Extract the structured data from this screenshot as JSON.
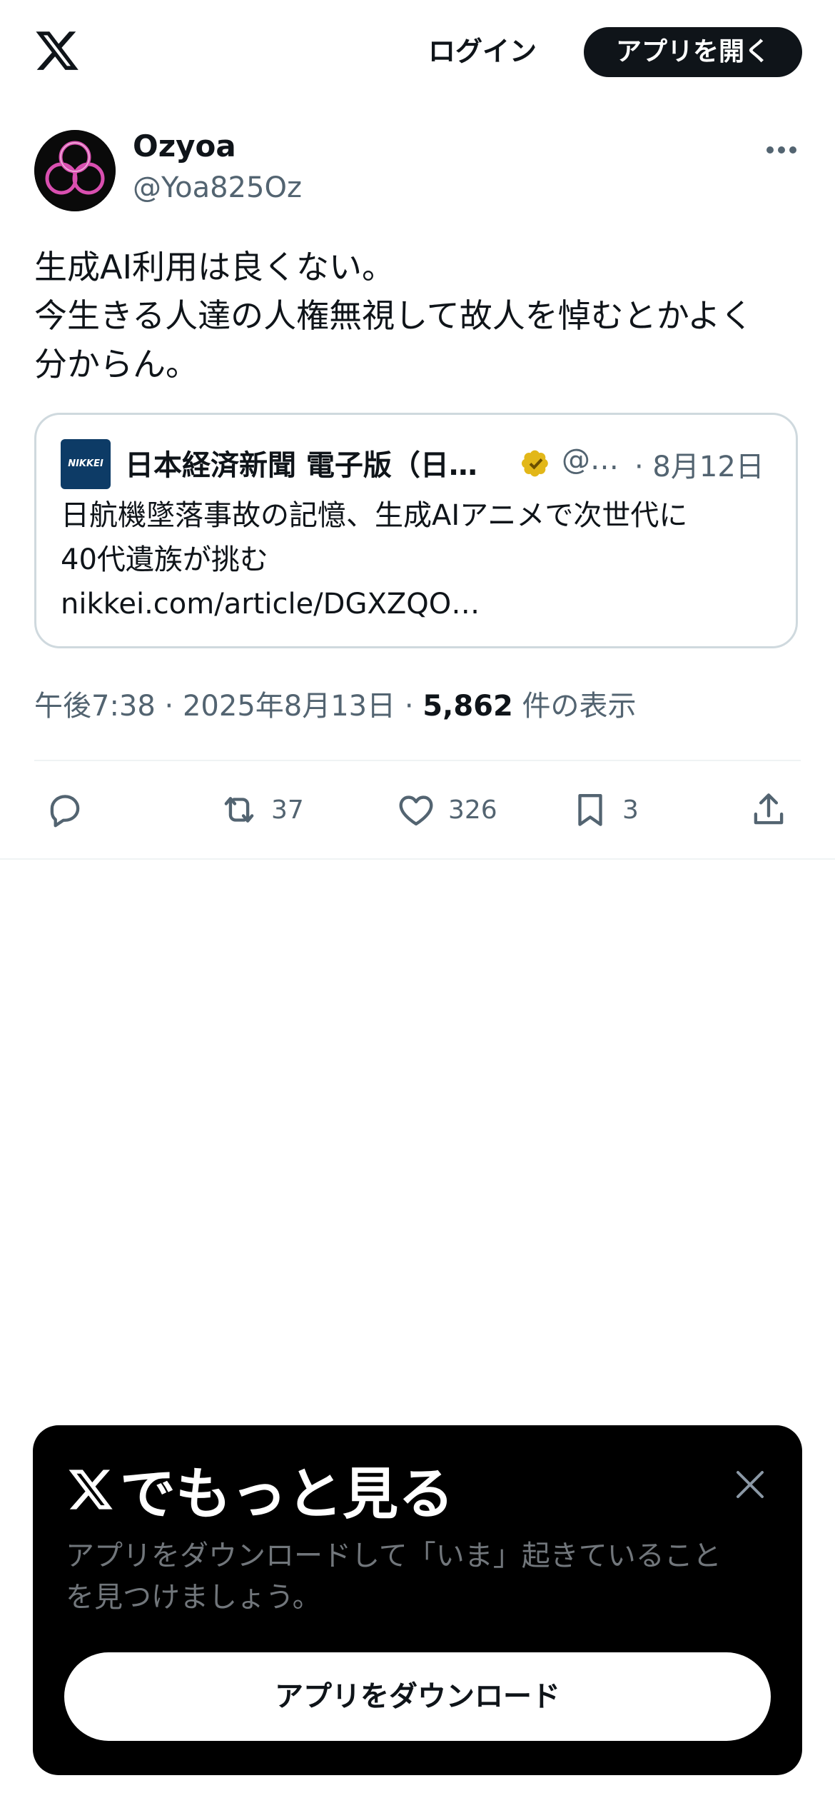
{
  "header": {
    "login_label": "ログイン",
    "open_app_label": "アプリを開く"
  },
  "post": {
    "display_name": "Ozyoa",
    "handle": "@Yoa825Oz",
    "text_lines": [
      "生成AI利用は良くない。",
      "今生きる人達の人権無視して故人を悼むとかよく",
      "分からん。"
    ],
    "quote": {
      "avatar_label": "NIKKEI",
      "display_name": "日本経済新聞 電子版（日…",
      "handle": "@…",
      "date": "· 8月12日",
      "text_lines": [
        "日航機墜落事故の記憶、生成AIアニメで次世代に",
        "40代遺族が挑む",
        "nikkei.com/article/DGXZQO…"
      ]
    },
    "time": "午後7:38",
    "date": "2025年8月13日",
    "separator": "·",
    "views_count": "5,862",
    "views_label": "件の表示"
  },
  "actions": {
    "reply_count": "",
    "repost_count": "37",
    "like_count": "326",
    "bookmark_count": "3"
  },
  "sheet": {
    "title": "でもっと見る",
    "description_lines": [
      "アプリをダウンロードして「いま」起きていること",
      "を見つけましょう。"
    ],
    "download_label": "アプリをダウンロード"
  },
  "colors": {
    "text_primary": "#0f1419",
    "text_secondary": "#536471",
    "border": "#cfd9de",
    "verified_gold": "#e2b719"
  }
}
